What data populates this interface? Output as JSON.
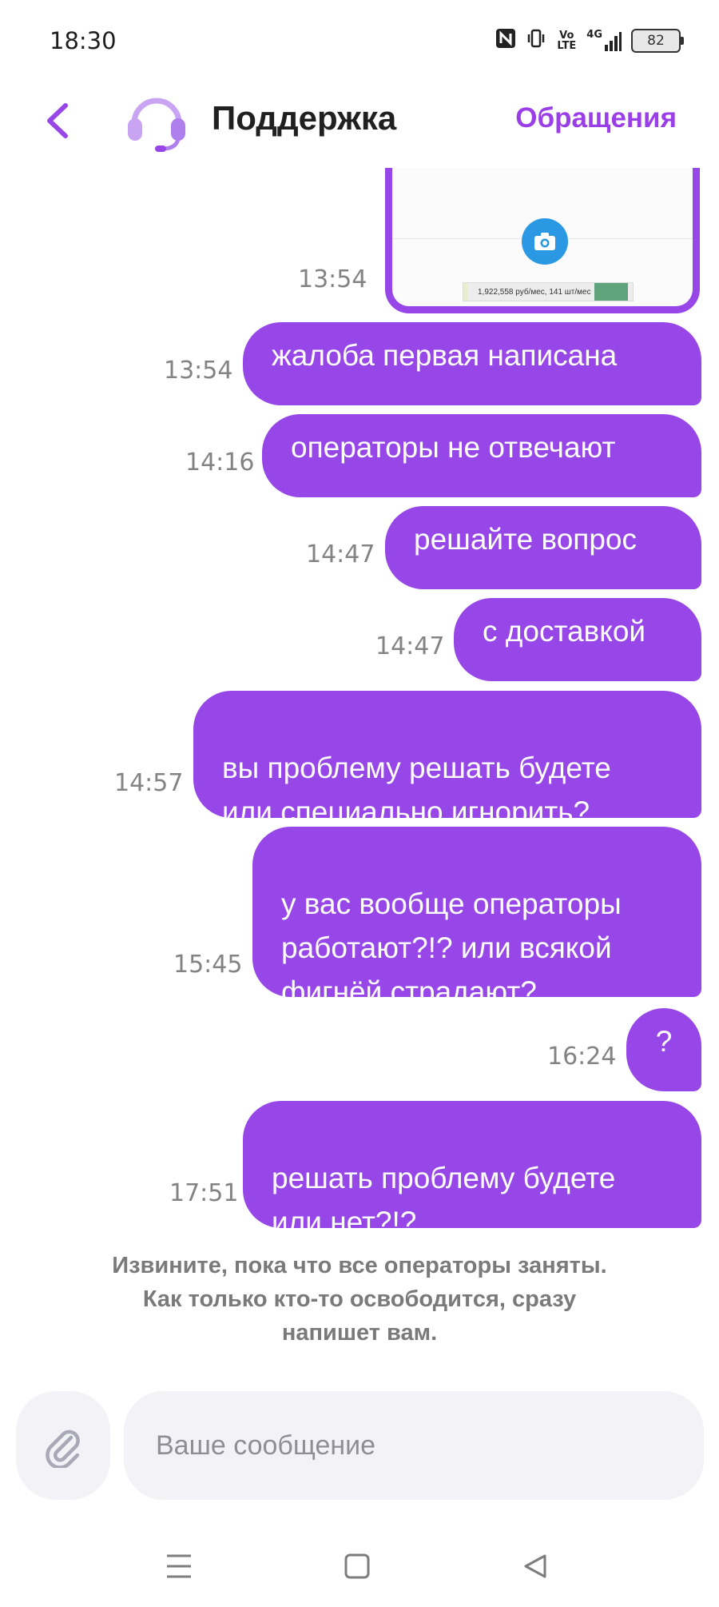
{
  "status_bar": {
    "time": "18:30",
    "icons": [
      "nfc-icon",
      "vibrate-icon",
      "volte-icon",
      "4g-signal-icon"
    ],
    "volte_label": "Vo LTE",
    "network_label": "4G",
    "battery_level": "82"
  },
  "header": {
    "title": "Поддержка",
    "link": "Обращения",
    "accent_color": "#9747e8"
  },
  "image_message": {
    "time": "13:54",
    "preview_text": "1,922,558 руб/мес, 141 шт/мес"
  },
  "messages": [
    {
      "text": "жалоба первая написана",
      "time": "13:54"
    },
    {
      "text": "операторы не отвечают",
      "time": "14:16"
    },
    {
      "text": "решайте вопрос",
      "time": "14:47"
    },
    {
      "text": "с доставкой",
      "time": "14:47"
    },
    {
      "text": "вы проблему решать будете\nили специально игнорить?",
      "time": "14:57"
    },
    {
      "text": "у вас вообще операторы\nработают?!? или всякой\nфигнёй страдают?",
      "time": "15:45"
    },
    {
      "text": "?",
      "time": "16:24"
    },
    {
      "text": "решать проблему будете\nили нет?!?",
      "time": "17:51"
    }
  ],
  "system_notice": "Извините, пока что все операторы заняты.\nКак только кто-то освободится, сразу\nнапишет вам.",
  "composer": {
    "placeholder": "Ваше сообщение"
  }
}
